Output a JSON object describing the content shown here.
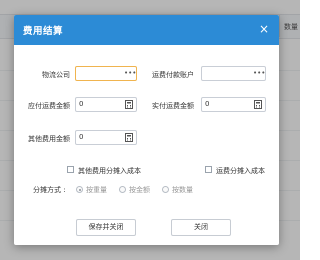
{
  "background": {
    "column_header": "数量"
  },
  "dialog": {
    "title": "费用结算",
    "close_label": "×",
    "fields": {
      "logistics_company": {
        "label": "物流公司",
        "value": ""
      },
      "freight_account": {
        "label": "运费付款账户",
        "value": ""
      },
      "freight_payable": {
        "label": "应付运费金额",
        "value": "0"
      },
      "freight_paid": {
        "label": "实付运费金额",
        "value": "0"
      },
      "other_fee": {
        "label": "其他费用金额",
        "value": "0"
      }
    },
    "checkboxes": {
      "other_fee_alloc": "其他费用分摊入成本",
      "freight_alloc": "运费分摊入成本"
    },
    "allocation": {
      "label": "分摊方式 :",
      "options": [
        "按重量",
        "按金额",
        "按数量"
      ],
      "selected": "按重量"
    },
    "buttons": {
      "save_close": "保存并关闭",
      "close": "关闭"
    }
  },
  "colors": {
    "header_bg": "#2c8bd6",
    "active_border": "#f0b44f"
  },
  "icons": {
    "ellipsis": "ellipsis-icon",
    "calculator": "calculator-icon",
    "close": "close-icon"
  }
}
